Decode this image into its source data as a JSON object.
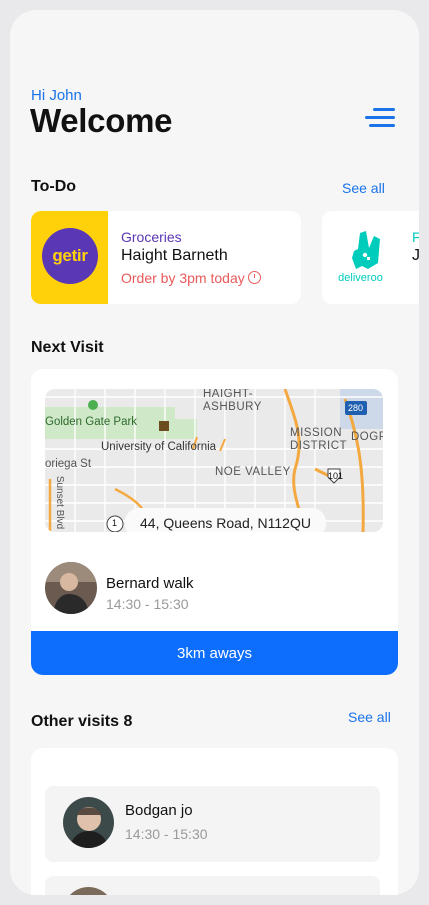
{
  "header": {
    "greeting": "Hi John",
    "title": "Welcome",
    "menu_icon": "hamburger-menu-icon"
  },
  "todo": {
    "section_title": "To-Do",
    "see_all_label": "See all",
    "cards": [
      {
        "brand": "getir",
        "brand_color": "#5a37b4",
        "logo_bg": "#ffd10b",
        "category": "Groceries",
        "name": "Haight Barneth",
        "due": "Order by 3pm today",
        "due_icon": "alarm-clock-icon"
      },
      {
        "brand": "deliveroo",
        "brand_color": "#00ccbc",
        "category": "F",
        "name": "J"
      }
    ]
  },
  "next_visit": {
    "section_title": "Next Visit",
    "map": {
      "labels": [
        "HAIGHT-",
        "ASHBURY",
        "Golden Gate Park",
        "University of California",
        "MISSION",
        "DISTRICT",
        "DOGP",
        "NOE VALLEY",
        "oriega St",
        "Sunset Blvd",
        "280",
        "101",
        "1"
      ]
    },
    "address": "44, Queens Road, N112QU",
    "person": {
      "name": "Bernard walk",
      "time": "14:30 - 15:30"
    },
    "distance_label": "3km aways"
  },
  "other_visits": {
    "section_title": "Other visits 8",
    "see_all_label": "See all",
    "items": [
      {
        "name": "Bodgan jo",
        "time": "14:30 - 15:30"
      }
    ]
  },
  "colors": {
    "accent": "#1a73e8",
    "primary_button": "#0d6efd",
    "due_text": "#e85a5a",
    "background": "#f6f6f7"
  }
}
